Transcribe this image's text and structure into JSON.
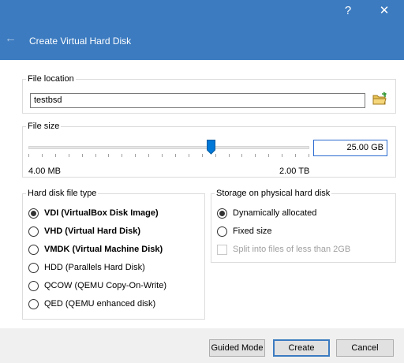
{
  "window": {
    "help_label": "?",
    "close_label": "✕"
  },
  "header": {
    "back_label": "←",
    "title": "Create Virtual Hard Disk"
  },
  "file_location": {
    "title": "File location",
    "value": "testbsd",
    "folder_icon": "folder-icon"
  },
  "file_size": {
    "title": "File size",
    "value": "25.00 GB",
    "min_label": "4.00 MB",
    "max_label": "2.00 TB",
    "slider_fraction": 0.65
  },
  "disk_type": {
    "title": "Hard disk file type",
    "options": [
      {
        "label": "VDI (VirtualBox Disk Image)",
        "checked": true,
        "bold": true
      },
      {
        "label": "VHD (Virtual Hard Disk)",
        "checked": false,
        "bold": true
      },
      {
        "label": "VMDK (Virtual Machine Disk)",
        "checked": false,
        "bold": true
      },
      {
        "label": "HDD (Parallels Hard Disk)",
        "checked": false,
        "bold": false
      },
      {
        "label": "QCOW (QEMU Copy-On-Write)",
        "checked": false,
        "bold": false
      },
      {
        "label": "QED (QEMU enhanced disk)",
        "checked": false,
        "bold": false
      }
    ]
  },
  "storage": {
    "title": "Storage on physical hard disk",
    "options": [
      {
        "label": "Dynamically allocated",
        "checked": true
      },
      {
        "label": "Fixed size",
        "checked": false
      }
    ],
    "split_label": "Split into files of less than 2GB",
    "split_enabled": false
  },
  "buttons": {
    "guided": "Guided Mode",
    "create": "Create",
    "cancel": "Cancel"
  },
  "colors": {
    "header": "#3c7bc0",
    "accent": "#2a6ad0"
  }
}
